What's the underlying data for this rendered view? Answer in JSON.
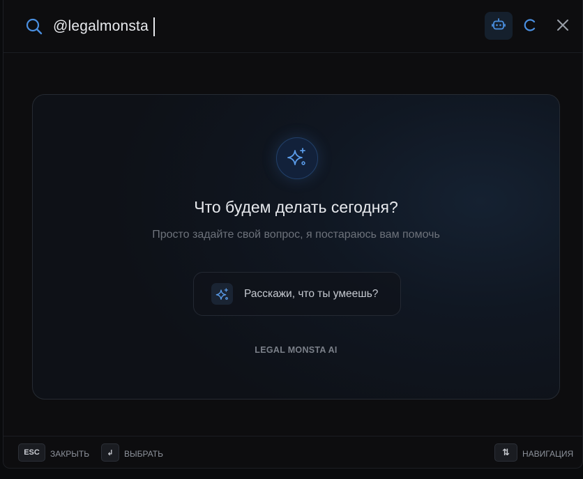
{
  "search": {
    "query": "@legalmonsta"
  },
  "empty_state": {
    "headline": "Что будем делать сегодня?",
    "subline": "Просто задайте свой вопрос, я постараюсь вам помочь",
    "suggestion_label": "Расскажи, что ты умеешь?",
    "brand": "LEGAL MONSTA AI"
  },
  "footer": {
    "esc_key": "ESC",
    "close_label": "ЗАКРЫТЬ",
    "enter_key": "↲",
    "select_label": "ВЫБРАТЬ",
    "nav_key": "⇅",
    "nav_label": "НАВИГАЦИЯ"
  },
  "icons": {
    "search": "search-icon",
    "bot": "robot-icon",
    "refresh": "refresh-icon",
    "close": "close-icon",
    "sparkles": "sparkles-icon"
  },
  "colors": {
    "accent": "#4a8fe0",
    "background": "#0d0d0f",
    "card_border": "#262b33"
  }
}
